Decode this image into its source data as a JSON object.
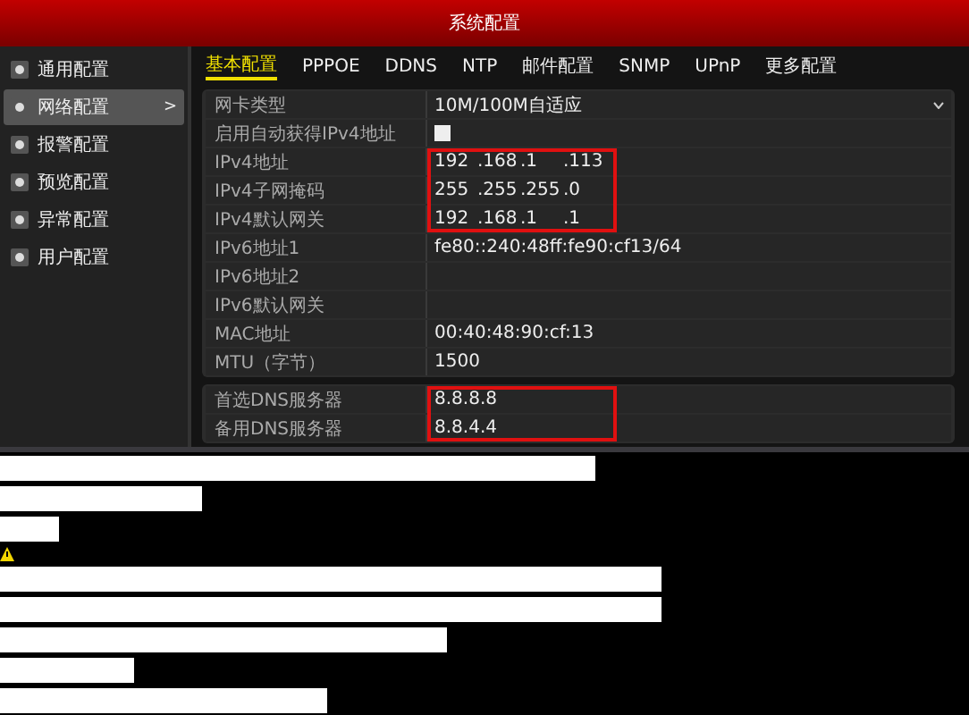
{
  "window": {
    "title": "系统配置"
  },
  "sidebar": {
    "items": [
      {
        "label": "通用配置",
        "selected": false
      },
      {
        "label": "网络配置",
        "selected": true,
        "arrow": ">"
      },
      {
        "label": "报警配置",
        "selected": false
      },
      {
        "label": "预览配置",
        "selected": false
      },
      {
        "label": "异常配置",
        "selected": false
      },
      {
        "label": "用户配置",
        "selected": false
      }
    ]
  },
  "tabs": [
    {
      "label": "基本配置",
      "selected": true
    },
    {
      "label": "PPPOE",
      "selected": false
    },
    {
      "label": "DDNS",
      "selected": false
    },
    {
      "label": "NTP",
      "selected": false
    },
    {
      "label": "邮件配置",
      "selected": false
    },
    {
      "label": "SNMP",
      "selected": false
    },
    {
      "label": "UPnP",
      "selected": false
    },
    {
      "label": "更多配置",
      "selected": false
    }
  ],
  "groups": [
    {
      "rows": [
        {
          "label": "网卡类型",
          "kind": "dropdown",
          "value": "10M/100M自适应",
          "highlighted": false
        },
        {
          "label": "启用自动获得IPv4地址",
          "kind": "checkbox",
          "checked": false,
          "highlighted": false
        },
        {
          "label": "IPv4地址",
          "kind": "ip",
          "parts": [
            "192",
            ".168",
            ".1",
            ".113"
          ],
          "highlighted": true
        },
        {
          "label": "IPv4子网掩码",
          "kind": "ip",
          "parts": [
            "255",
            ".255",
            ".255",
            ".0"
          ],
          "highlighted": true
        },
        {
          "label": "IPv4默认网关",
          "kind": "ip",
          "parts": [
            "192",
            ".168",
            ".1",
            ".1"
          ],
          "highlighted": true
        },
        {
          "label": "IPv6地址1",
          "kind": "text",
          "value": "fe80::240:48ff:fe90:cf13/64",
          "highlighted": false
        },
        {
          "label": "IPv6地址2",
          "kind": "text",
          "highlighted": false
        },
        {
          "label": "IPv6默认网关",
          "kind": "text",
          "highlighted": false
        },
        {
          "label": "MAC地址",
          "kind": "text",
          "value": "00:40:48:90:cf:13",
          "highlighted": false
        },
        {
          "label": "MTU（字节）",
          "kind": "text",
          "value": "1500",
          "highlighted": false
        }
      ]
    },
    {
      "rows": [
        {
          "label": "首选DNS服务器",
          "kind": "text",
          "value": "8.8.8.8",
          "highlighted": true
        },
        {
          "label": "备用DNS服务器",
          "kind": "text",
          "value": "8.8.4.4",
          "highlighted": true
        }
      ]
    }
  ]
}
